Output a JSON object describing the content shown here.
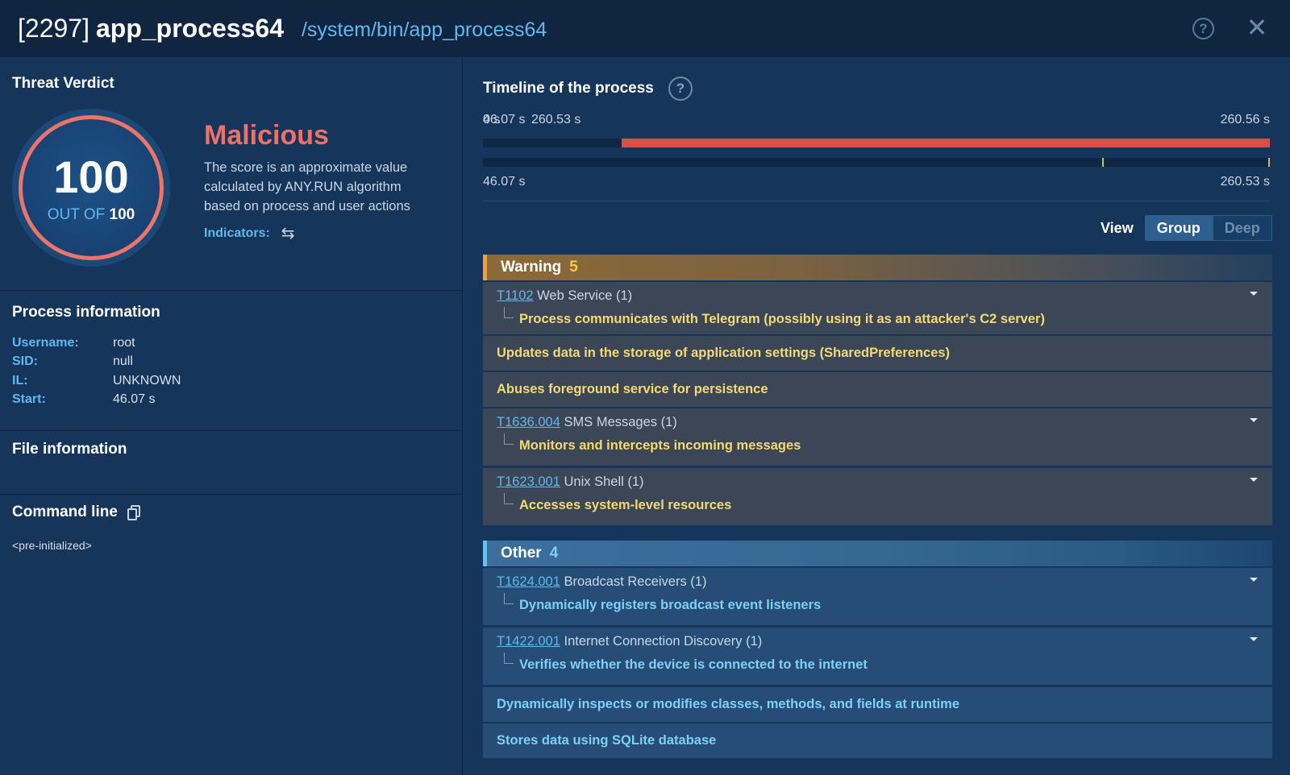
{
  "header": {
    "pid": "[2297]",
    "process_name": "app_process64",
    "path": "/system/bin/app_process64",
    "help_icon": "?",
    "close_icon": "✕"
  },
  "verdict": {
    "title": "Threat Verdict",
    "score": "100",
    "out_of_label": "OUT OF",
    "out_of_value": "100",
    "label": "Malicious",
    "description": "The score is an approximate value calculated by ANY.RUN algorithm based on process and user actions",
    "indicators_label": "Indicators:",
    "color": "#ee7168"
  },
  "process_info": {
    "title": "Process information",
    "fields": [
      {
        "key": "Username:",
        "value": "root"
      },
      {
        "key": "SID:",
        "value": "null"
      },
      {
        "key": "IL:",
        "value": "UNKNOWN"
      },
      {
        "key": "Start:",
        "value": "46.07 s"
      }
    ]
  },
  "file_info": {
    "title": "File information"
  },
  "command_line": {
    "title": "Command line",
    "value": "<pre-initialized>"
  },
  "timeline": {
    "title": "Timeline of the process",
    "top_left_overlap_a": "46.07 s",
    "top_left_overlap_b": "0 s",
    "top_mid": "260.53 s",
    "top_right": "260.56 s",
    "bottom_left": "46.07 s",
    "bottom_right": "260.53 s",
    "progress_start_fraction": 0.176
  },
  "view": {
    "label": "View",
    "options": [
      "Group",
      "Deep"
    ],
    "selected": "Group"
  },
  "groups": {
    "warning": {
      "label": "Warning",
      "count": "5",
      "items": [
        {
          "tid": "T1102",
          "tname": " Web Service (1)",
          "sub": "Process communicates with Telegram (possibly using it as an attacker's C2 server)"
        },
        {
          "single": "Updates data in the storage of application settings (SharedPreferences)"
        },
        {
          "single": "Abuses foreground service for persistence"
        },
        {
          "tid": "T1636.004",
          "tname": " SMS Messages (1)",
          "sub": "Monitors and intercepts incoming messages"
        },
        {
          "tid": "T1623.001",
          "tname": " Unix Shell (1)",
          "sub": "Accesses system-level resources"
        }
      ]
    },
    "other": {
      "label": "Other",
      "count": "4",
      "items": [
        {
          "tid": "T1624.001",
          "tname": " Broadcast Receivers (1)",
          "sub": "Dynamically registers broadcast event listeners"
        },
        {
          "tid": "T1422.001",
          "tname": " Internet Connection Discovery (1)",
          "sub": "Verifies whether the device is connected to the internet"
        },
        {
          "single": "Dynamically inspects or modifies classes, methods, and fields at runtime"
        },
        {
          "single": "Stores data using SQLite database"
        }
      ]
    }
  }
}
